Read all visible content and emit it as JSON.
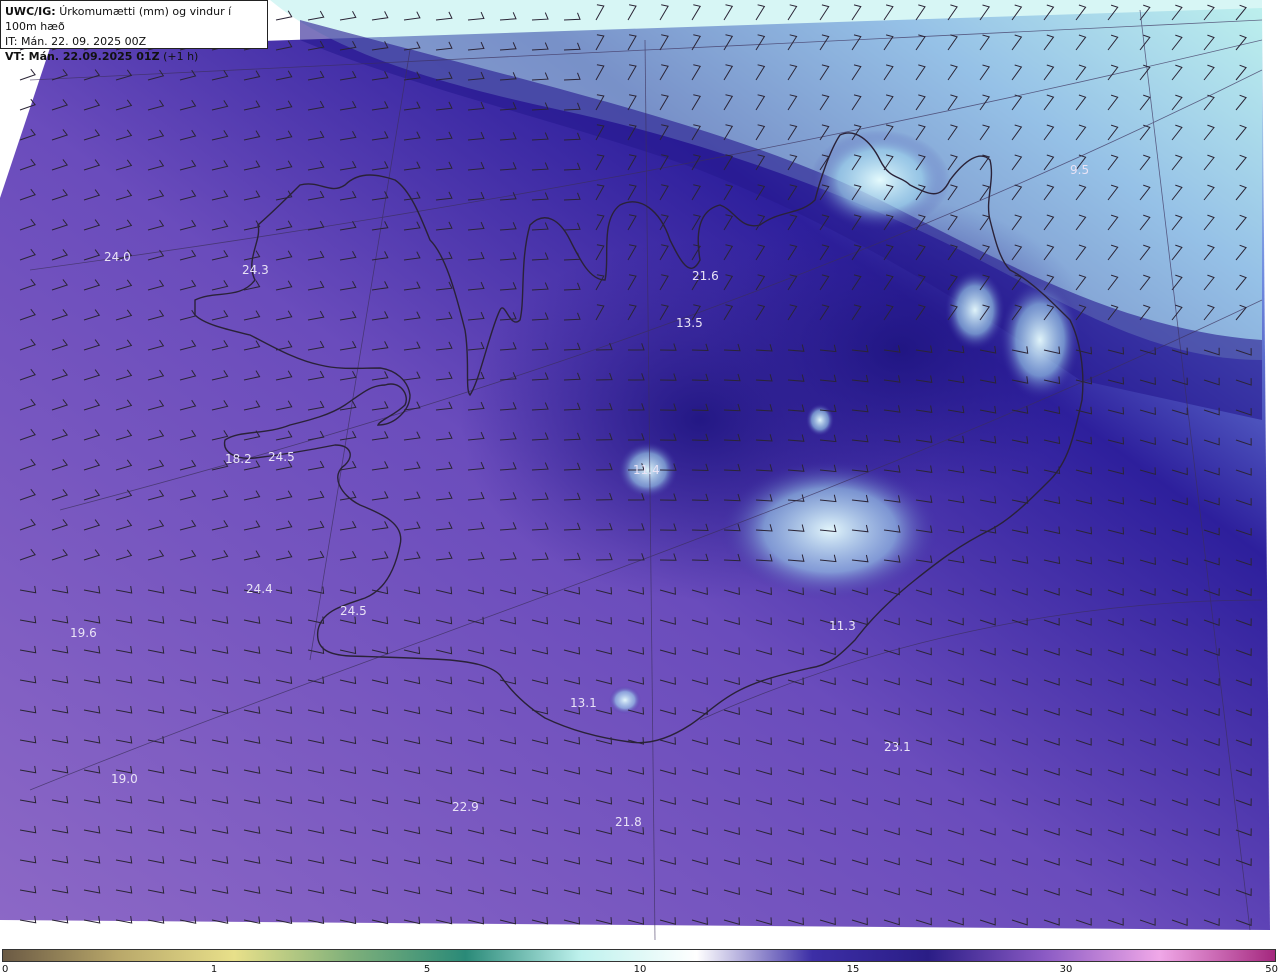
{
  "title": {
    "prefix": "UWC/IG:",
    "description": "Úrkomumætti (mm) og vindur í 100m hæð",
    "initial_time": "IT: Mán. 22. 09. 2025 00Z",
    "valid_prefix": "VT: Mán. 22.09.2025 01Z",
    "valid_suffix": "(+1 h)"
  },
  "colors": {
    "background": "#ffffff",
    "field_low": "#8a62c2",
    "field_mid": "#3a2a9c",
    "field_high": "#b8f0ee",
    "coastline": "#2a2238",
    "barbs": "#2b2536",
    "labels": "#e9e3f6"
  },
  "value_labels": [
    {
      "text": "24.0"
    },
    {
      "text": "24.3"
    },
    {
      "text": "21.6"
    },
    {
      "text": "13.5"
    },
    {
      "text": "18.2"
    },
    {
      "text": "24.5"
    },
    {
      "text": "11.4"
    },
    {
      "text": "24.4"
    },
    {
      "text": "24.5"
    },
    {
      "text": "19.6"
    },
    {
      "text": "11.3"
    },
    {
      "text": "13.1"
    },
    {
      "text": "23.1"
    },
    {
      "text": "19.0"
    },
    {
      "text": "22.9"
    },
    {
      "text": "21.8"
    },
    {
      "text": "9.5"
    }
  ],
  "colorbar": {
    "ticks": [
      {
        "label": "0",
        "value": 0
      },
      {
        "label": "1",
        "value": 1
      },
      {
        "label": "5",
        "value": 5
      },
      {
        "label": "10",
        "value": 10
      },
      {
        "label": "15",
        "value": 15
      },
      {
        "label": "30",
        "value": 30
      },
      {
        "label": "50",
        "value": 50
      }
    ],
    "stops": [
      "#6b5a44",
      "#b9a86a",
      "#e8e08a",
      "#7fb07a",
      "#2a8a78",
      "#bff2ee",
      "#ffffff",
      "#3c2ea6",
      "#2a1d86",
      "#8a5ac4",
      "#f0a8e8",
      "#a4287e"
    ]
  }
}
